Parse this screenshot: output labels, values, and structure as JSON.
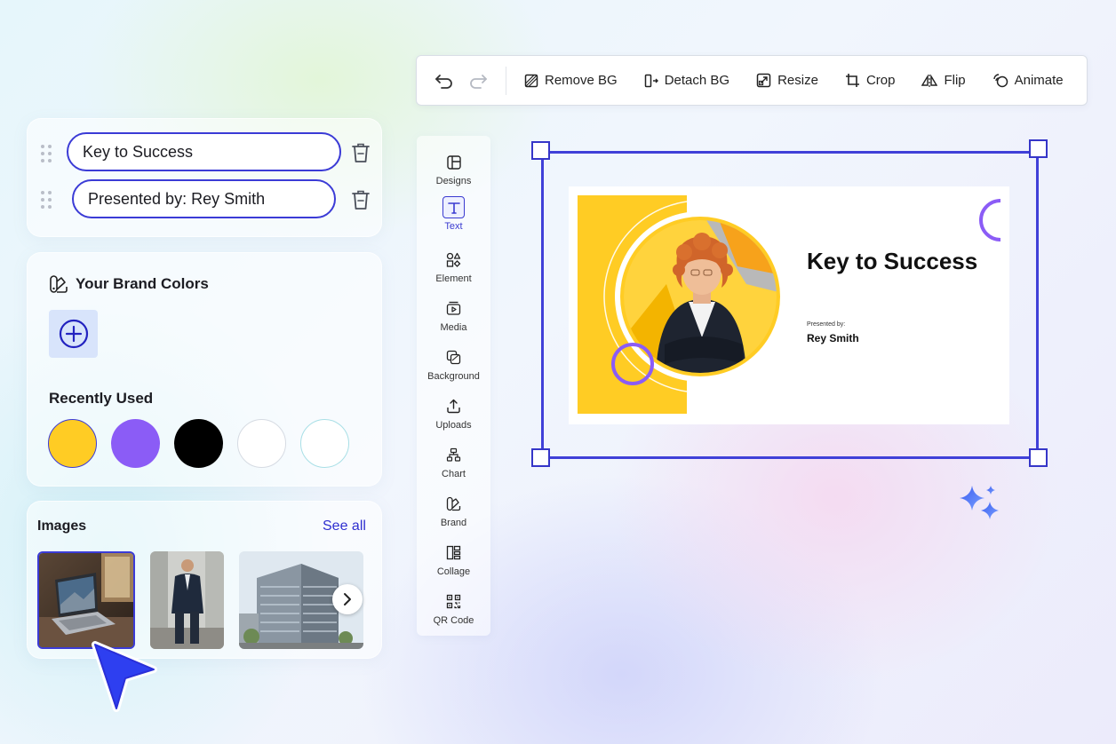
{
  "toolbar": {
    "actions": [
      {
        "label": "Remove BG",
        "icon": "remove-bg-icon"
      },
      {
        "label": "Detach BG",
        "icon": "detach-bg-icon"
      },
      {
        "label": "Resize",
        "icon": "resize-icon"
      },
      {
        "label": "Crop",
        "icon": "crop-icon"
      },
      {
        "label": "Flip",
        "icon": "flip-icon"
      },
      {
        "label": "Animate",
        "icon": "animate-icon"
      }
    ]
  },
  "text_layers": [
    {
      "value": "Key to Success"
    },
    {
      "value": "Presented by: Rey Smith"
    }
  ],
  "brand": {
    "title": "Your Brand Colors",
    "recently_used_title": "Recently Used",
    "recent_colors": [
      "#FFCC24",
      "#8B5CF6",
      "#000000",
      "#FFFFFF",
      "#FFFFFF"
    ]
  },
  "images": {
    "title": "Images",
    "see_all": "See all"
  },
  "tools": [
    {
      "label": "Designs",
      "icon": "designs-icon"
    },
    {
      "label": "Text",
      "icon": "text-icon",
      "active": true
    },
    {
      "label": "Element",
      "icon": "element-icon"
    },
    {
      "label": "Media",
      "icon": "media-icon"
    },
    {
      "label": "Background",
      "icon": "background-icon"
    },
    {
      "label": "Uploads",
      "icon": "uploads-icon"
    },
    {
      "label": "Chart",
      "icon": "chart-icon"
    },
    {
      "label": "Brand",
      "icon": "brand-icon"
    },
    {
      "label": "Collage",
      "icon": "collage-icon"
    },
    {
      "label": "QR Code",
      "icon": "qr-code-icon"
    }
  ],
  "slide": {
    "title": "Key to Success",
    "presented_label": "Presented by:",
    "presenter": "Rey Smith"
  },
  "colors": {
    "accent": "#3B3BD6",
    "slide_yellow": "#FFCC24",
    "slide_purple": "#8B5CF6"
  }
}
